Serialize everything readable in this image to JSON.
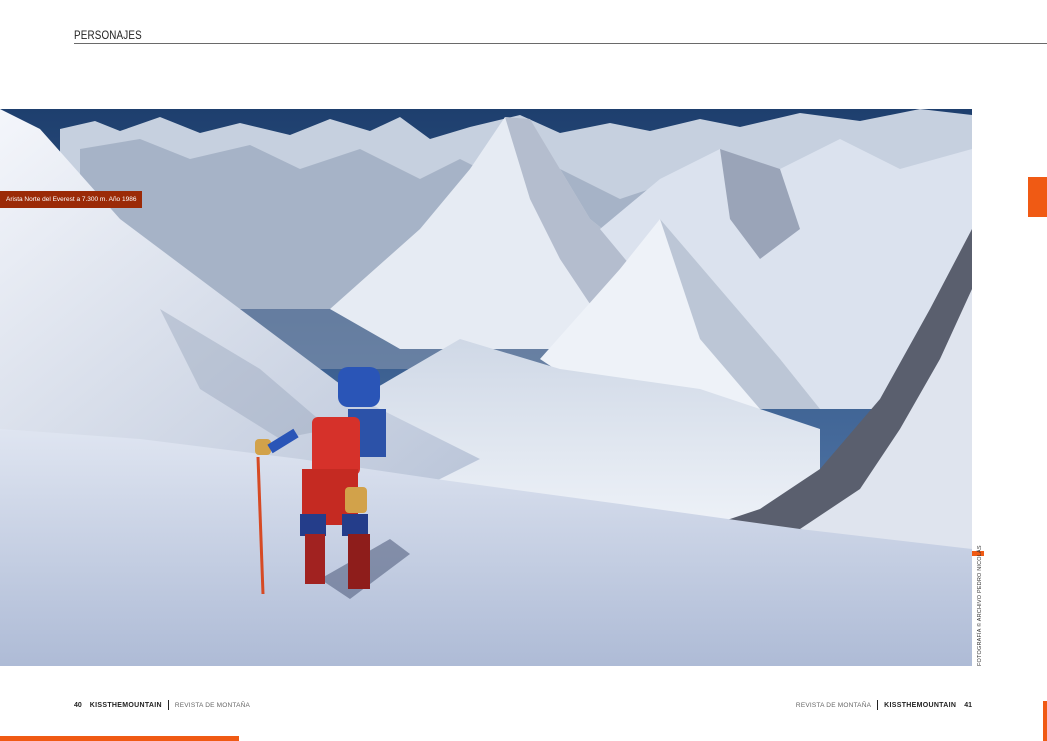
{
  "header": {
    "section": "PERSONAJES"
  },
  "photo": {
    "subject": "climber-on-snow-slope",
    "caption": "Arista Norte del Everest a 7.300 m. Año 1986",
    "credit": "FOTOGRAFÍA © ARCHIVO PEDRO NICOLÁS"
  },
  "footer_left": {
    "page": "40",
    "brand": "KISSTHEMOUNTAIN",
    "subtitle": "REVISTA DE MONTAÑA"
  },
  "footer_right": {
    "subtitle": "REVISTA DE MONTAÑA",
    "brand": "KISSTHEMOUNTAIN",
    "page": "41"
  },
  "colors": {
    "accent": "#f05a14",
    "caption_bg": "#9b2a07",
    "sky": "#2f5a8c",
    "snow": "#e9eef6"
  }
}
